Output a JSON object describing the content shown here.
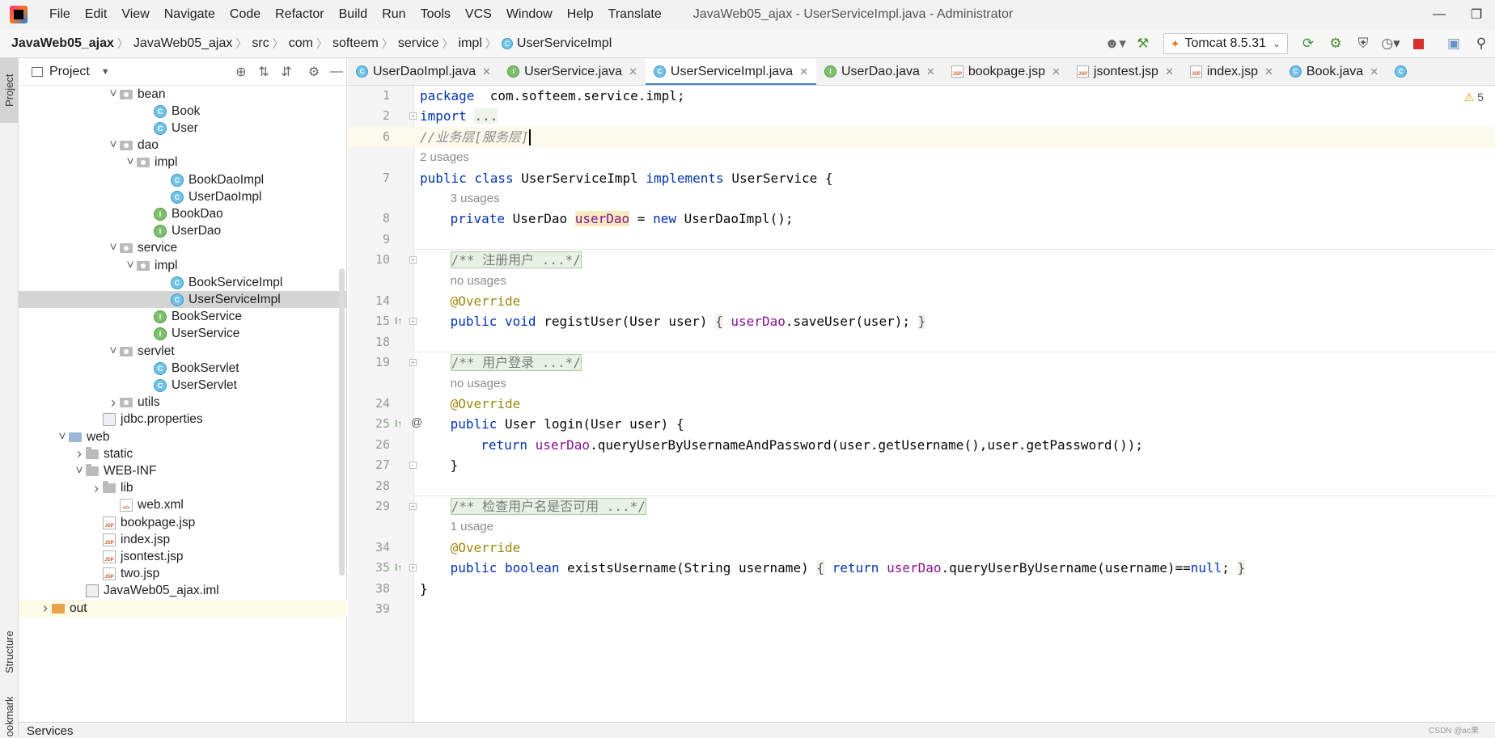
{
  "menu": {
    "items": [
      "File",
      "Edit",
      "View",
      "Navigate",
      "Code",
      "Refactor",
      "Build",
      "Run",
      "Tools",
      "VCS",
      "Window",
      "Help",
      "Translate"
    ],
    "window_title": "JavaWeb05_ajax - UserServiceImpl.java - Administrator"
  },
  "breadcrumb": [
    "JavaWeb05_ajax",
    "JavaWeb05_ajax",
    "src",
    "com",
    "softeem",
    "service",
    "impl",
    "UserServiceImpl"
  ],
  "toolbar": {
    "run_config": "Tomcat 8.5.31",
    "icons": [
      "user-icon",
      "build-hammer-icon",
      "run-icon",
      "debug-icon",
      "coverage-icon",
      "profile-icon",
      "stop-icon",
      "layout-icon",
      "search-icon"
    ]
  },
  "left_strip": {
    "project": "Project",
    "structure": "Structure",
    "bookmarks": "Bookmarks"
  },
  "project_panel": {
    "title": "Project",
    "tree": [
      {
        "label": "bean",
        "type": "pkg",
        "depth": 5,
        "arrow": "down"
      },
      {
        "label": "Book",
        "type": "cls",
        "depth": 7
      },
      {
        "label": "User",
        "type": "cls",
        "depth": 7
      },
      {
        "label": "dao",
        "type": "pkg",
        "depth": 5,
        "arrow": "down"
      },
      {
        "label": "impl",
        "type": "pkg",
        "depth": 6,
        "arrow": "down"
      },
      {
        "label": "BookDaoImpl",
        "type": "cls",
        "depth": 8
      },
      {
        "label": "UserDaoImpl",
        "type": "cls",
        "depth": 8
      },
      {
        "label": "BookDao",
        "type": "intf",
        "depth": 7
      },
      {
        "label": "UserDao",
        "type": "intf",
        "depth": 7
      },
      {
        "label": "service",
        "type": "pkg",
        "depth": 5,
        "arrow": "down"
      },
      {
        "label": "impl",
        "type": "pkg",
        "depth": 6,
        "arrow": "down"
      },
      {
        "label": "BookServiceImpl",
        "type": "cls",
        "depth": 8
      },
      {
        "label": "UserServiceImpl",
        "type": "cls",
        "depth": 8,
        "selected": true
      },
      {
        "label": "BookService",
        "type": "intf",
        "depth": 7
      },
      {
        "label": "UserService",
        "type": "intf",
        "depth": 7
      },
      {
        "label": "servlet",
        "type": "pkg",
        "depth": 5,
        "arrow": "down"
      },
      {
        "label": "BookServlet",
        "type": "cls",
        "depth": 7
      },
      {
        "label": "UserServlet",
        "type": "cls",
        "depth": 7
      },
      {
        "label": "utils",
        "type": "pkg",
        "depth": 5,
        "arrow": "right"
      },
      {
        "label": "jdbc.properties",
        "type": "file",
        "depth": 4
      },
      {
        "label": "web",
        "type": "folder-blue",
        "depth": 2,
        "arrow": "down"
      },
      {
        "label": "static",
        "type": "folder",
        "depth": 3,
        "arrow": "right"
      },
      {
        "label": "WEB-INF",
        "type": "folder",
        "depth": 3,
        "arrow": "down"
      },
      {
        "label": "lib",
        "type": "folder",
        "depth": 4,
        "arrow": "right"
      },
      {
        "label": "web.xml",
        "type": "xml",
        "depth": 5
      },
      {
        "label": "bookpage.jsp",
        "type": "jsp",
        "depth": 4
      },
      {
        "label": "index.jsp",
        "type": "jsp",
        "depth": 4
      },
      {
        "label": "jsontest.jsp",
        "type": "jsp",
        "depth": 4
      },
      {
        "label": "two.jsp",
        "type": "jsp",
        "depth": 4
      },
      {
        "label": "JavaWeb05_ajax.iml",
        "type": "iml",
        "depth": 3
      },
      {
        "label": "out",
        "type": "folder-orange",
        "depth": 1,
        "arrow": "right",
        "highlight": true
      }
    ]
  },
  "editor_tabs": [
    {
      "label": "UserDaoImpl.java",
      "type": "cls"
    },
    {
      "label": "UserService.java",
      "type": "intf"
    },
    {
      "label": "UserServiceImpl.java",
      "type": "cls",
      "active": true
    },
    {
      "label": "UserDao.java",
      "type": "intf"
    },
    {
      "label": "bookpage.jsp",
      "type": "jsp"
    },
    {
      "label": "jsontest.jsp",
      "type": "jsp"
    },
    {
      "label": "index.jsp",
      "type": "jsp"
    },
    {
      "label": "Book.java",
      "type": "cls"
    },
    {
      "label": "",
      "type": "cls"
    }
  ],
  "editor": {
    "warnings": "5",
    "lines": [
      {
        "num": "1",
        "tokens": [
          [
            "kw",
            "package"
          ],
          [
            "",
            "  com.softeem.service.impl;"
          ]
        ]
      },
      {
        "num": "2",
        "fold": "+",
        "tokens": [
          [
            "kw",
            "import"
          ],
          [
            "",
            " "
          ],
          [
            "fold-blk",
            "..."
          ]
        ]
      },
      {
        "num": "6",
        "current": true,
        "caret": true,
        "tokens": [
          [
            "cmt",
            "//业务层[服务层]"
          ]
        ]
      },
      {
        "num": "",
        "inlay": "2 usages"
      },
      {
        "num": "7",
        "tokens": [
          [
            "kw",
            "public class"
          ],
          [
            "",
            " UserServiceImpl "
          ],
          [
            "kw",
            "implements"
          ],
          [
            "",
            " UserService {"
          ]
        ]
      },
      {
        "num": "",
        "inlay": "3 usages",
        "indent": 1
      },
      {
        "num": "8",
        "indent": 1,
        "tokens": [
          [
            "kw",
            "private"
          ],
          [
            "",
            " UserDao "
          ],
          [
            "field usage-hl",
            "userDao"
          ],
          [
            "",
            " = "
          ],
          [
            "kw",
            "new"
          ],
          [
            "",
            " UserDaoImpl();"
          ]
        ]
      },
      {
        "num": "9",
        "tokens": []
      },
      {
        "num": "10",
        "fold": "+",
        "sep": true,
        "indent": 1,
        "tokens": [
          [
            "cmt doc-fold",
            "/** 注册用户 ...*/"
          ]
        ]
      },
      {
        "num": "",
        "inlay": "no usages",
        "indent": 1
      },
      {
        "num": "14",
        "indent": 1,
        "tokens": [
          [
            "ann",
            "@Override"
          ]
        ]
      },
      {
        "num": "15",
        "fold": "+",
        "mark": "I↑",
        "indent": 1,
        "tokens": [
          [
            "kw",
            "public void"
          ],
          [
            "",
            " registUser(User user) "
          ],
          [
            "fold-blk",
            "{"
          ],
          [
            "",
            " "
          ],
          [
            "field",
            "userDao"
          ],
          [
            "",
            ".saveUser(user); "
          ],
          [
            "fold-blk",
            "}"
          ]
        ]
      },
      {
        "num": "18",
        "tokens": []
      },
      {
        "num": "19",
        "fold": "+",
        "sep": true,
        "indent": 1,
        "tokens": [
          [
            "cmt doc-fold",
            "/** 用户登录 ...*/"
          ]
        ]
      },
      {
        "num": "",
        "inlay": "no usages",
        "indent": 1
      },
      {
        "num": "24",
        "indent": 1,
        "tokens": [
          [
            "ann",
            "@Override"
          ]
        ]
      },
      {
        "num": "25",
        "fold": "-",
        "mark": "I↑",
        "at": "@",
        "indent": 1,
        "tokens": [
          [
            "kw",
            "public"
          ],
          [
            "",
            " User login(User user) {"
          ]
        ]
      },
      {
        "num": "26",
        "indent": 2,
        "tokens": [
          [
            "kw",
            "return"
          ],
          [
            "",
            " "
          ],
          [
            "field",
            "userDao"
          ],
          [
            "",
            ".queryUserByUsernameAndPassword(user.getUsername(),user.getPassword());"
          ]
        ]
      },
      {
        "num": "27",
        "fold": "-",
        "indent": 1,
        "tokens": [
          [
            "",
            "}"
          ]
        ]
      },
      {
        "num": "28",
        "tokens": []
      },
      {
        "num": "29",
        "fold": "+",
        "sep": true,
        "indent": 1,
        "tokens": [
          [
            "cmt doc-fold",
            "/** 检查用户名是否可用 ...*/"
          ]
        ]
      },
      {
        "num": "",
        "inlay": "1 usage",
        "indent": 1
      },
      {
        "num": "34",
        "indent": 1,
        "tokens": [
          [
            "ann",
            "@Override"
          ]
        ]
      },
      {
        "num": "35",
        "fold": "+",
        "mark": "I↑",
        "indent": 1,
        "tokens": [
          [
            "kw",
            "public boolean"
          ],
          [
            "",
            " existsUsername(String username) "
          ],
          [
            "fold-blk",
            "{"
          ],
          [
            "",
            " "
          ],
          [
            "kw",
            "return"
          ],
          [
            "",
            " "
          ],
          [
            "field",
            "userDao"
          ],
          [
            "",
            ".queryUserByUsername(username)=="
          ],
          [
            "kw",
            "null"
          ],
          [
            "",
            "; "
          ],
          [
            "fold-blk",
            "}"
          ]
        ]
      },
      {
        "num": "38",
        "tokens": [
          [
            "",
            "}"
          ]
        ]
      },
      {
        "num": "39",
        "tokens": []
      }
    ]
  },
  "bottom": {
    "services": "Services",
    "watermark": "CSDN @ac果"
  }
}
